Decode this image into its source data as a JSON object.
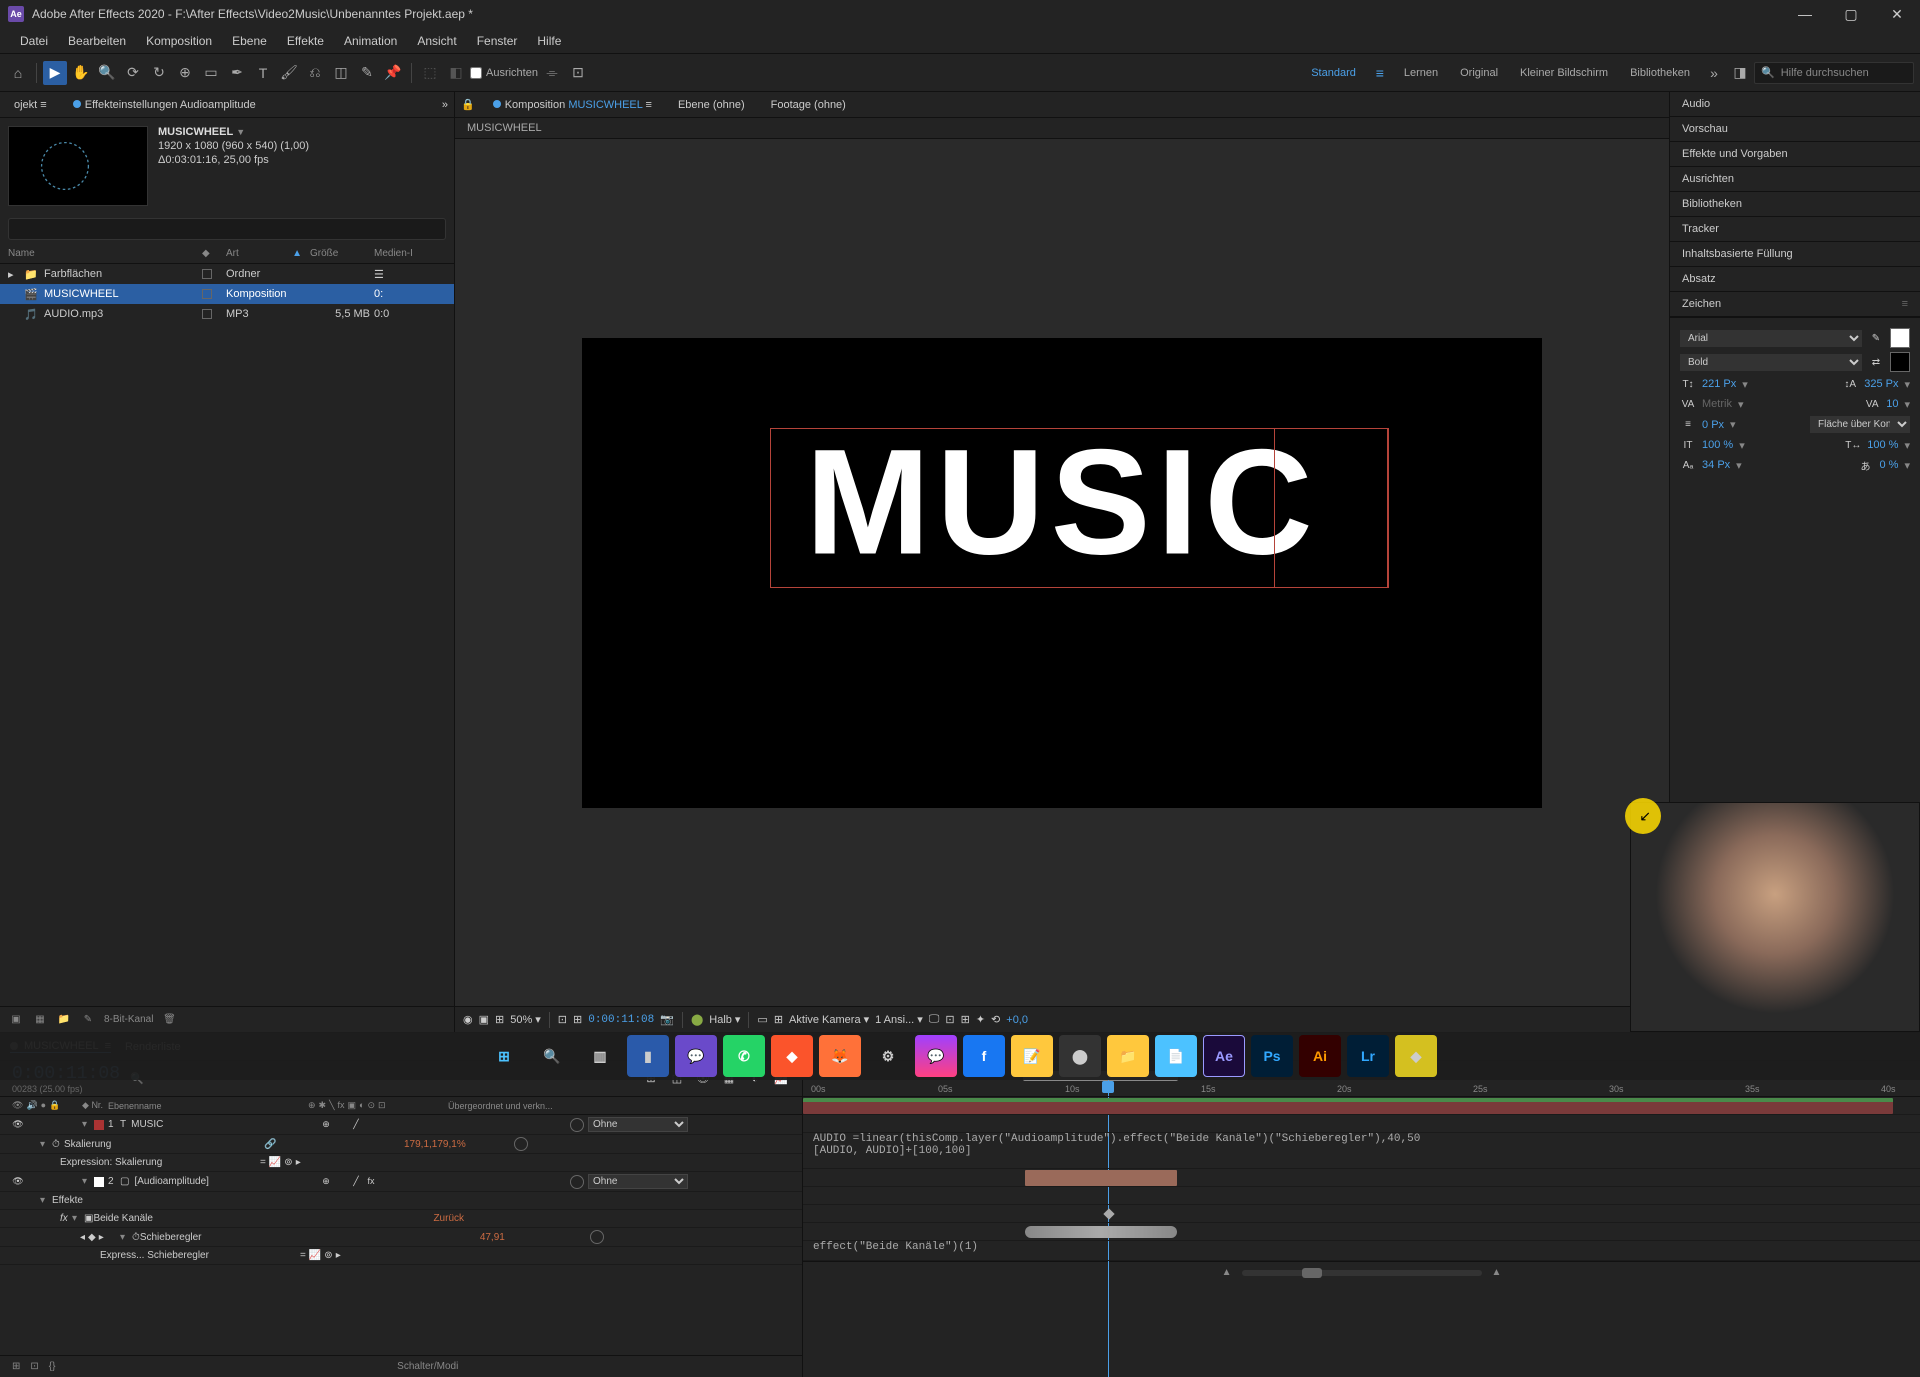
{
  "titlebar": {
    "app": "Adobe After Effects 2020",
    "path": "F:\\After Effects\\Video2Music\\Unbenanntes Projekt.aep *"
  },
  "menu": [
    "Datei",
    "Bearbeiten",
    "Komposition",
    "Ebene",
    "Effekte",
    "Animation",
    "Ansicht",
    "Fenster",
    "Hilfe"
  ],
  "toolbar": {
    "snap": "Ausrichten",
    "search_placeholder": "Hilfe durchsuchen"
  },
  "workspaces": [
    "Standard",
    "Lernen",
    "Original",
    "Kleiner Bildschirm",
    "Bibliotheken"
  ],
  "project": {
    "tab_effect": "Effekteinstellungen Audioamplitude",
    "tab_project": "ojekt",
    "comp_name": "MUSICWHEEL",
    "comp_dims": "1920 x 1080 (960 x 540) (1,00)",
    "comp_dur": "Δ0:03:01:16, 25,00 fps",
    "search_placeholder": "",
    "columns": {
      "name": "Name",
      "art": "Art",
      "size": "Größe",
      "media": "Medien-I"
    },
    "rows": [
      {
        "name": "Farbflächen",
        "art": "Ordner",
        "size": "",
        "media": "",
        "type": "folder"
      },
      {
        "name": "MUSICWHEEL",
        "art": "Komposition",
        "size": "",
        "media": "0:",
        "type": "comp",
        "selected": true
      },
      {
        "name": "AUDIO.mp3",
        "art": "MP3",
        "size": "5,5 MB",
        "media": "0:0",
        "type": "audio"
      }
    ],
    "footer_bit": "8-Bit-Kanal"
  },
  "viewer": {
    "tabs": {
      "comp_prefix": "Komposition",
      "comp_name": "MUSICWHEEL",
      "layer": "Ebene (ohne)",
      "footage": "Footage (ohne)"
    },
    "crumb": "MUSICWHEEL",
    "text": "MUSIC",
    "footer": {
      "zoom": "50%",
      "timecode": "0:00:11:08",
      "res": "Halb",
      "camera": "Aktive Kamera",
      "views": "1 Ansi...",
      "plus": "+0,0"
    }
  },
  "right_panels": [
    "Audio",
    "Vorschau",
    "Effekte und Vorgaben",
    "Ausrichten",
    "Bibliotheken",
    "Tracker",
    "Inhaltsbasierte Füllung",
    "Absatz",
    "Zeichen"
  ],
  "char": {
    "font": "Arial",
    "weight": "Bold",
    "size": "221",
    "sizeUnit": "Px",
    "leading": "325",
    "leadingUnit": "Px",
    "kerning": "Metrik",
    "tracking": "10",
    "stroke": "0",
    "strokeUnit": "Px",
    "fill_opt": "Fläche über Kon...",
    "hscale": "100 %",
    "vscale": "100 %",
    "baseline": "34",
    "baselineUnit": "Px",
    "tsume": "0 %"
  },
  "timeline": {
    "tab": "MUSICWHEEL",
    "render": "Renderliste",
    "timecode": "0:00:11:08",
    "sub": "00283 (25.00 fps)",
    "col": {
      "nr": "Nr.",
      "name": "Ebenenname",
      "parent": "Übergeordnet und verkn..."
    },
    "ticks": [
      "00s",
      "05s",
      "10s",
      "15s",
      "20s",
      "25s",
      "30s",
      "35s",
      "40s"
    ],
    "layers": [
      {
        "idx": "1",
        "name": "MUSIC",
        "type": "text",
        "label": "#a33",
        "parent": "Ohne",
        "children": [
          {
            "prop": "Skalierung",
            "value": "179,1,179,1%",
            "expr_lbl": "Expression: Skalierung"
          }
        ]
      },
      {
        "idx": "2",
        "name": "[Audioamplitude]",
        "type": "solid",
        "label": "#fff",
        "parent": "Ohne",
        "children": [
          {
            "prop": "Effekte",
            "children": [
              {
                "prop": "Beide Kanäle",
                "value": "Zurück",
                "children": [
                  {
                    "prop": "Schieberegler",
                    "value": "47,91",
                    "expr_lbl": "Express... Schieberegler"
                  }
                ]
              }
            ]
          }
        ]
      }
    ],
    "expr1": "AUDIO =linear(thisComp.layer(\"Audioamplitude\").effect(\"Beide Kanäle\")(\"Schieberegler\"),40,50\n[AUDIO, AUDIO]+[100,100]",
    "expr2": "effect(\"Beide Kanäle\")(1)",
    "footer": "Schalter/Modi"
  }
}
